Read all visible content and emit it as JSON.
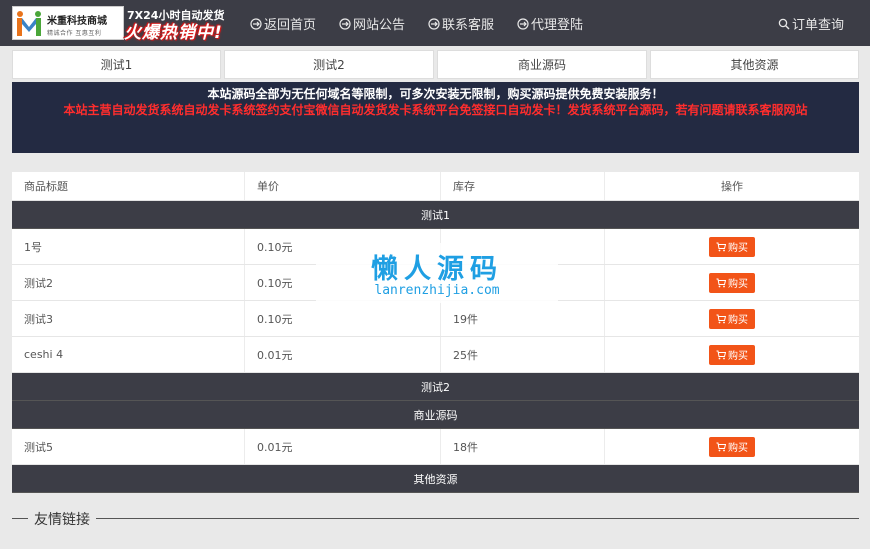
{
  "header": {
    "logo_name": "米重科技商城",
    "logo_sub": "精诚合作 互惠互利",
    "promo_top": "7X24小时自动发货",
    "promo_main": "火爆热销中!",
    "nav": [
      {
        "label": "返回首页",
        "icon": "circle-arrow-icon"
      },
      {
        "label": "网站公告",
        "icon": "announcement-icon"
      },
      {
        "label": "联系客服",
        "icon": "service-icon"
      },
      {
        "label": "代理登陆",
        "icon": "agent-icon"
      }
    ],
    "order_query": "订单查询"
  },
  "tabs": [
    "测试1",
    "测试2",
    "商业源码",
    "其他资源"
  ],
  "notice": {
    "line1": "本站源码全部为无任何域名等限制，可多次安装无限制，购买源码提供免费安装服务！",
    "line2": "本站主营自动发货系统自动发卡系统签约支付宝微信自动发货发卡系统平台免签接口自动发卡！发货系统平台源码，若有问题请联系客服网站",
    "line1_color": "#ffffff",
    "line2_color": "#ff2d2d"
  },
  "table": {
    "headers": [
      "商品标题",
      "单价",
      "库存",
      "操作"
    ],
    "categories": [
      {
        "name": "测试1",
        "items": [
          {
            "title": "1号",
            "price": "0.10元",
            "stock": "",
            "action": "购买"
          },
          {
            "title": "测试2",
            "price": "0.10元",
            "stock": "",
            "action": "购买"
          },
          {
            "title": "测试3",
            "price": "0.10元",
            "stock": "19件",
            "action": "购买"
          },
          {
            "title": "ceshi 4",
            "price": "0.01元",
            "stock": "25件",
            "action": "购买"
          }
        ]
      },
      {
        "name": "测试2",
        "items": []
      },
      {
        "name": "商业源码",
        "items": [
          {
            "title": "测试5",
            "price": "0.01元",
            "stock": "18件",
            "action": "购买"
          }
        ]
      },
      {
        "name": "其他资源",
        "items": []
      }
    ]
  },
  "watermark": {
    "title": "懒人源码",
    "url": "lanrenzhijia.com"
  },
  "footer": {
    "links_title": "友情链接"
  },
  "colors": {
    "header_bg": "#3c3d46",
    "notice_bg": "#232a42",
    "buy_button": "#f25418",
    "watermark": "#1f9fe3"
  }
}
